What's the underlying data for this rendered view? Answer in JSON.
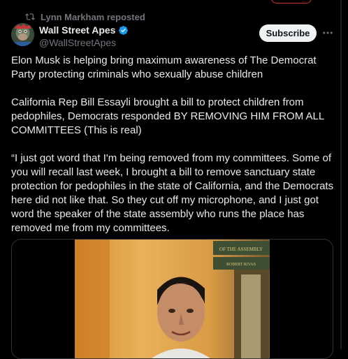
{
  "repost": {
    "text": "Lynn Markham reposted",
    "icon": "repost-icon"
  },
  "author": {
    "display_name": "Wall Street Apes",
    "handle": "@WallStreetApes",
    "verified": true,
    "verified_color": "#1d9bf0"
  },
  "actions": {
    "subscribe_label": "Subscribe",
    "more_icon": "more-icon"
  },
  "tweet": {
    "paragraphs": [
      "Elon Musk is helping bring maximum awareness of The Democrat Party protecting criminals who sexually abuse children",
      "California Rep Bill Essayli brought a bill to protect children from pedophiles, Democrats responded BY REMOVING HIM FROM ALL COMMITTEES (This is real)",
      "“I just got word that I'm being removed from my committees. Some of you will recall last week, I brought a bill to remove sanctuary state protection for pedophiles in the state of California, and the Democrats here did not like that. So they cut off my microphone, and I just got word the speaker of the state assembly who runs the place has removed me from my committees."
    ]
  },
  "media": {
    "sign_line1": "OF THE ASSEMBLY",
    "sign_line2": "ROBERT RIVAS"
  },
  "colors": {
    "background": "#000000",
    "text": "#e7e9ea",
    "muted": "#71767b",
    "border": "#2f3336"
  }
}
